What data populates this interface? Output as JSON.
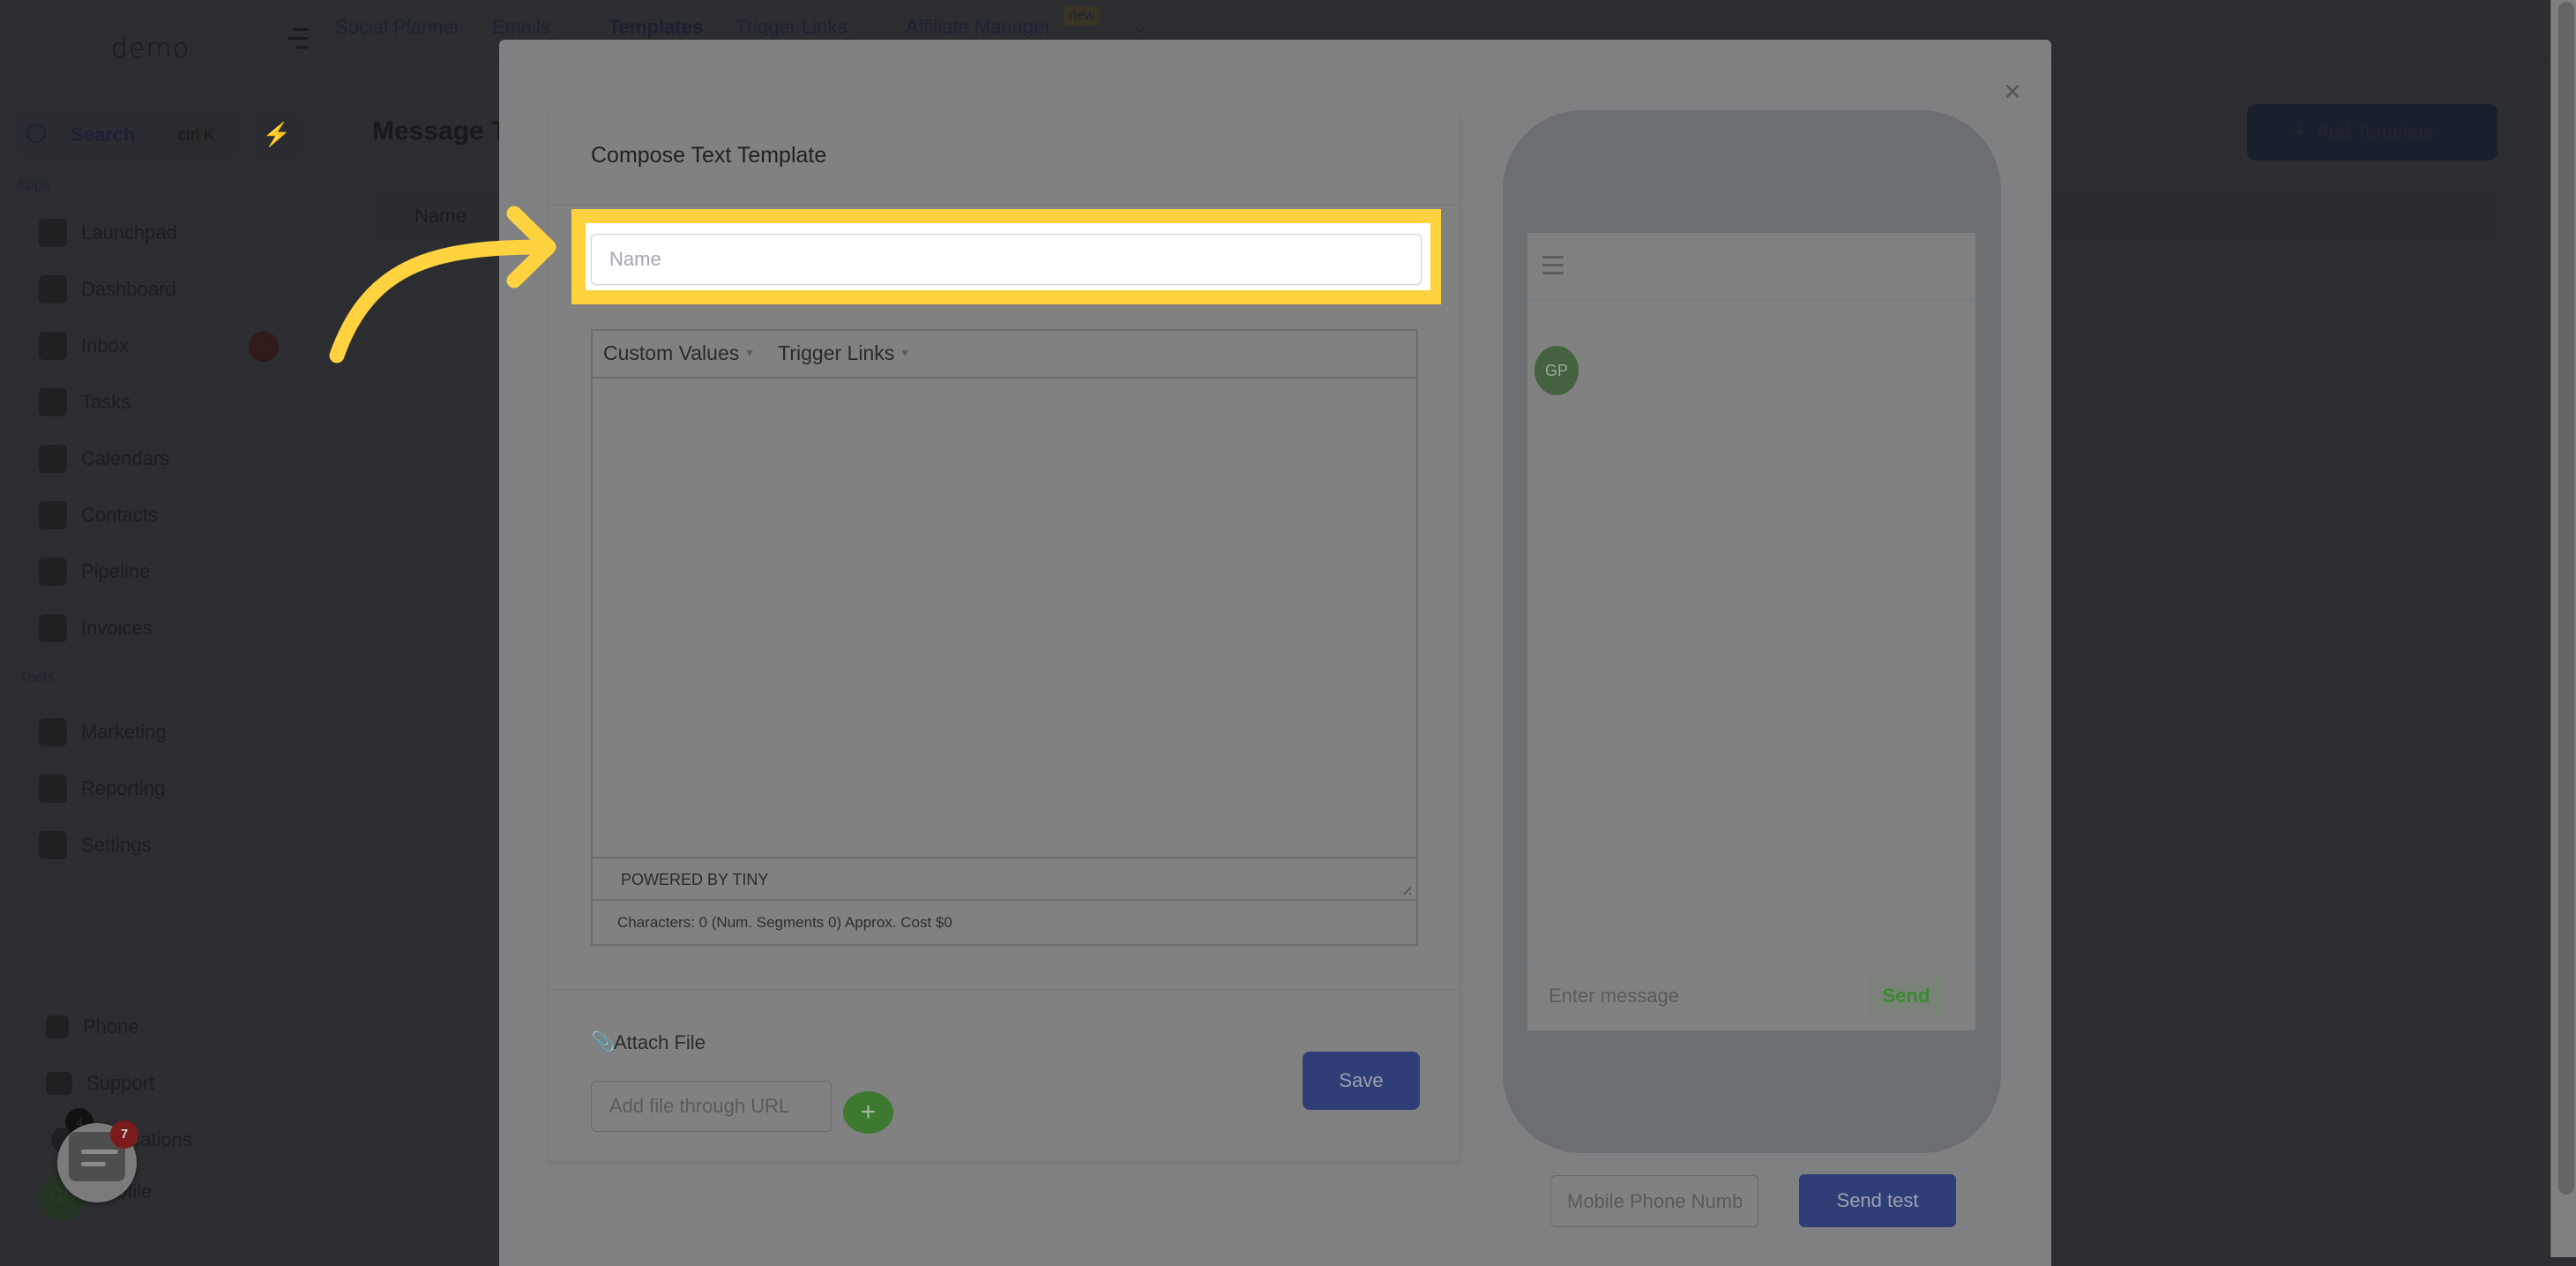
{
  "app": {
    "logo": "demo",
    "search": {
      "label": "Search",
      "shortcut": "ctrl K"
    },
    "sidebar": {
      "apps_section": "Apps",
      "tools_section": "Tools",
      "apps": [
        {
          "label": "Launchpad",
          "icon": "launchpad-icon"
        },
        {
          "label": "Dashboard",
          "icon": "dashboard-icon"
        },
        {
          "label": "Inbox",
          "icon": "inbox-icon",
          "badge": "1"
        },
        {
          "label": "Tasks",
          "icon": "tasks-icon"
        },
        {
          "label": "Calendars",
          "icon": "calendar-icon"
        },
        {
          "label": "Contacts",
          "icon": "contacts-icon"
        },
        {
          "label": "Pipeline",
          "icon": "pipeline-icon"
        },
        {
          "label": "Invoices",
          "icon": "invoices-icon"
        }
      ],
      "tools": [
        {
          "label": "Marketing",
          "icon": "megaphone-icon"
        },
        {
          "label": "Reporting",
          "icon": "pie-chart-icon"
        },
        {
          "label": "Settings",
          "icon": "gear-icon"
        }
      ],
      "bottom": [
        {
          "label": "Phone",
          "icon": "phone-icon"
        },
        {
          "label": "Support",
          "icon": "support-icon"
        },
        {
          "label": "Notifications",
          "icon": "bell-icon",
          "badge": "4"
        },
        {
          "label": "Profile",
          "icon": "avatar-icon",
          "initials": "GP"
        }
      ]
    },
    "topnav": [
      {
        "label": "Social Planner"
      },
      {
        "label": "Emails",
        "has_dropdown": true
      },
      {
        "label": "Templates",
        "active": true
      },
      {
        "label": "Trigger Links",
        "has_dropdown": true
      },
      {
        "label": "Affiliate Manager",
        "badge": "new"
      }
    ],
    "page": {
      "title": "Message Templates",
      "table_headers": [
        "Name"
      ],
      "add_template_label": "Add Template"
    },
    "chat_widget": {
      "badge": "7"
    }
  },
  "modal": {
    "compose": {
      "title": "Compose Text Template",
      "name_placeholder": "Name",
      "name_value": "",
      "toolbar": [
        "Custom Values",
        "Trigger Links"
      ],
      "powered_by": "POWERED BY TINY",
      "characters_info": "Characters: 0 (Num. Segments 0) Approx. Cost $0",
      "attach_label": "Attach File",
      "url_placeholder": "Add file through URL",
      "save_label": "Save"
    },
    "preview": {
      "avatar_initials": "GP",
      "message_placeholder": "Enter message",
      "send_label": "Send",
      "phone_placeholder": "Mobile Phone Number",
      "send_test_label": "Send test"
    }
  },
  "colors": {
    "highlight": "#ffd23f",
    "primary_button": "#2f3e77",
    "success": "#3d7a2f",
    "overlay_modal": "#7f8081"
  }
}
